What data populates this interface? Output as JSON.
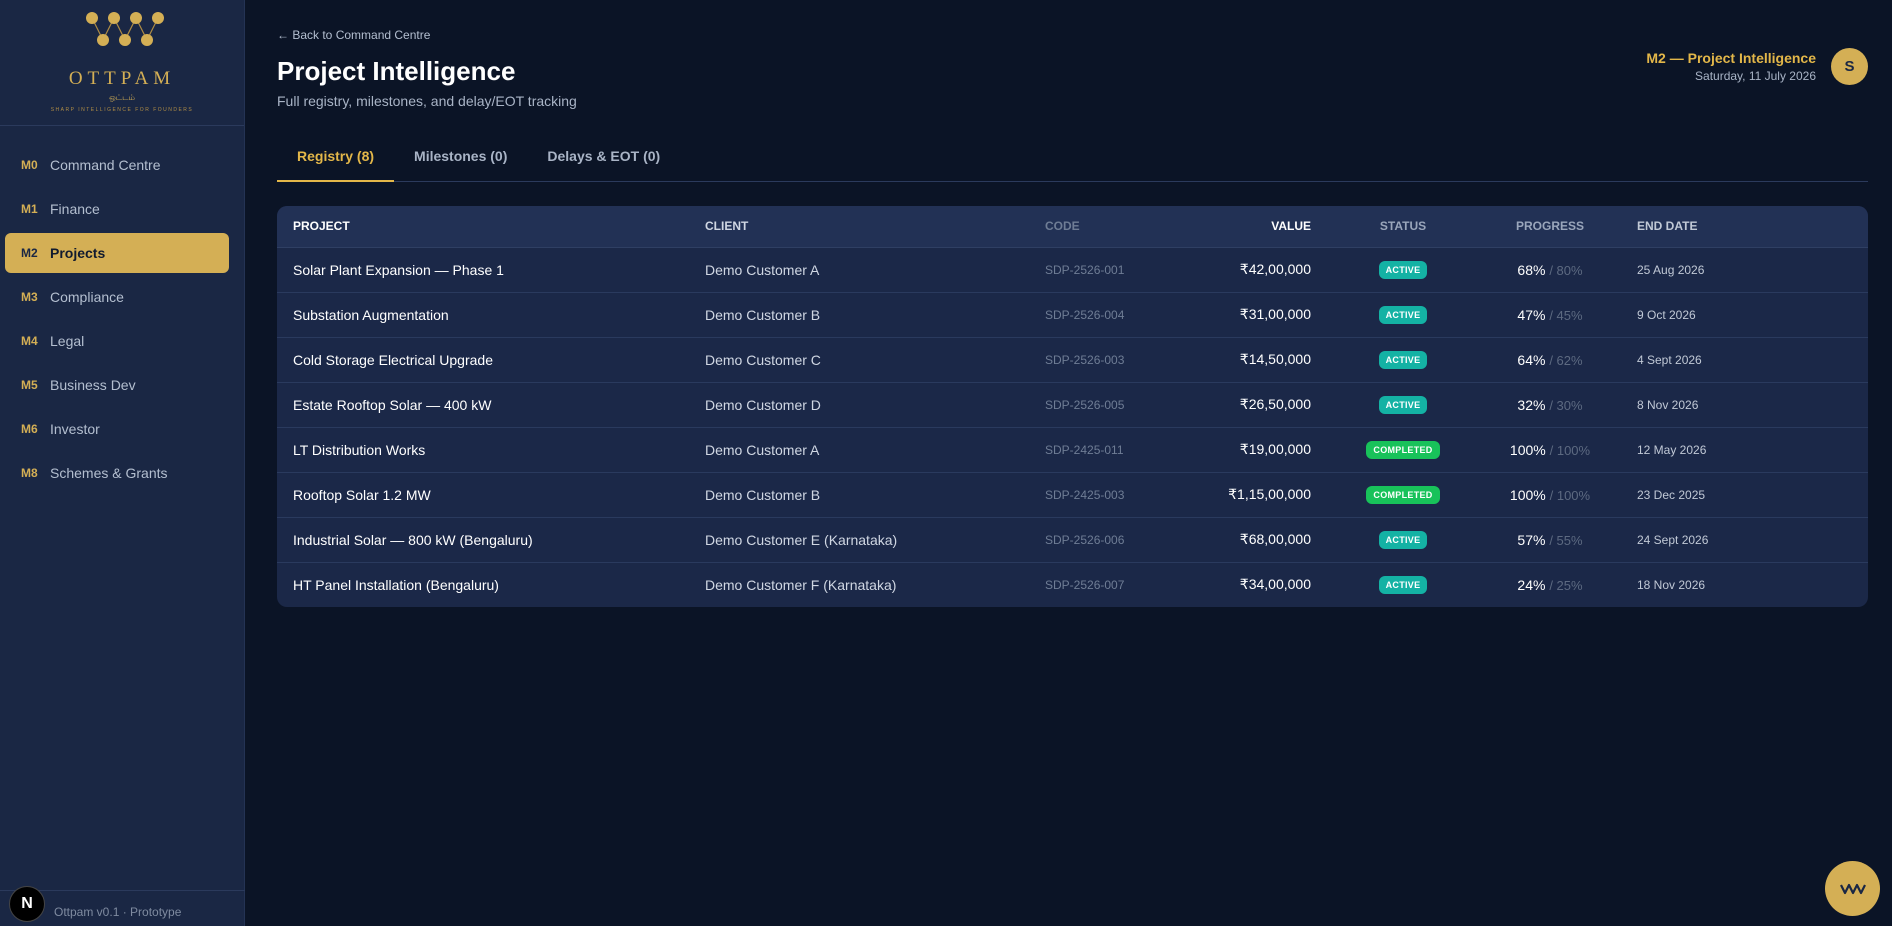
{
  "brand": {
    "name": "OTTPAM",
    "subname": "ஒட்டம்",
    "tagline": "SHARP INTELLIGENCE FOR FOUNDERS",
    "accent": "#d4af55"
  },
  "sidebar": {
    "items": [
      {
        "code": "M0",
        "label": "Command Centre",
        "active": false
      },
      {
        "code": "M1",
        "label": "Finance",
        "active": false
      },
      {
        "code": "M2",
        "label": "Projects",
        "active": true
      },
      {
        "code": "M3",
        "label": "Compliance",
        "active": false
      },
      {
        "code": "M4",
        "label": "Legal",
        "active": false
      },
      {
        "code": "M5",
        "label": "Business Dev",
        "active": false
      },
      {
        "code": "M6",
        "label": "Investor",
        "active": false
      },
      {
        "code": "M8",
        "label": "Schemes & Grants",
        "active": false
      }
    ],
    "footer": "Ottpam v0.1 · Prototype",
    "next_badge": "N"
  },
  "header": {
    "back_link": "← Back to Command Centre",
    "title": "Project Intelligence",
    "subtitle": "Full registry, milestones, and delay/EOT tracking",
    "module": "M2 — Project Intelligence",
    "date": "Saturday, 11 July 2026",
    "avatar": "S"
  },
  "tabs": [
    {
      "label": "Registry (8)",
      "active": true
    },
    {
      "label": "Milestones (0)",
      "active": false
    },
    {
      "label": "Delays & EOT (0)",
      "active": false
    }
  ],
  "table": {
    "columns": [
      "Project",
      "Client",
      "Code",
      "Value",
      "Status",
      "Progress",
      "End Date"
    ],
    "rows": [
      {
        "project": "Solar Plant Expansion — Phase 1",
        "client": "Demo Customer A",
        "code": "SDP-2526-001",
        "value": "₹42,00,000",
        "status": "ACTIVE",
        "progress": "68%",
        "planned": "/ 80%",
        "end": "25 Aug 2026"
      },
      {
        "project": "Substation Augmentation",
        "client": "Demo Customer B",
        "code": "SDP-2526-004",
        "value": "₹31,00,000",
        "status": "ACTIVE",
        "progress": "47%",
        "planned": "/ 45%",
        "end": "9 Oct 2026"
      },
      {
        "project": "Cold Storage Electrical Upgrade",
        "client": "Demo Customer C",
        "code": "SDP-2526-003",
        "value": "₹14,50,000",
        "status": "ACTIVE",
        "progress": "64%",
        "planned": "/ 62%",
        "end": "4 Sept 2026"
      },
      {
        "project": "Estate Rooftop Solar — 400 kW",
        "client": "Demo Customer D",
        "code": "SDP-2526-005",
        "value": "₹26,50,000",
        "status": "ACTIVE",
        "progress": "32%",
        "planned": "/ 30%",
        "end": "8 Nov 2026"
      },
      {
        "project": "LT Distribution Works",
        "client": "Demo Customer A",
        "code": "SDP-2425-011",
        "value": "₹19,00,000",
        "status": "COMPLETED",
        "progress": "100%",
        "planned": "/ 100%",
        "end": "12 May 2026"
      },
      {
        "project": "Rooftop Solar 1.2 MW",
        "client": "Demo Customer B",
        "code": "SDP-2425-003",
        "value": "₹1,15,00,000",
        "status": "COMPLETED",
        "progress": "100%",
        "planned": "/ 100%",
        "end": "23 Dec 2025"
      },
      {
        "project": "Industrial Solar — 800 kW (Bengaluru)",
        "client": "Demo Customer E (Karnataka)",
        "code": "SDP-2526-006",
        "value": "₹68,00,000",
        "status": "ACTIVE",
        "progress": "57%",
        "planned": "/ 55%",
        "end": "24 Sept 2026"
      },
      {
        "project": "HT Panel Installation (Bengaluru)",
        "client": "Demo Customer F (Karnataka)",
        "code": "SDP-2526-007",
        "value": "₹34,00,000",
        "status": "ACTIVE",
        "progress": "24%",
        "planned": "/ 25%",
        "end": "18 Nov 2026"
      }
    ]
  },
  "fab": {
    "icon": "wave-icon"
  }
}
